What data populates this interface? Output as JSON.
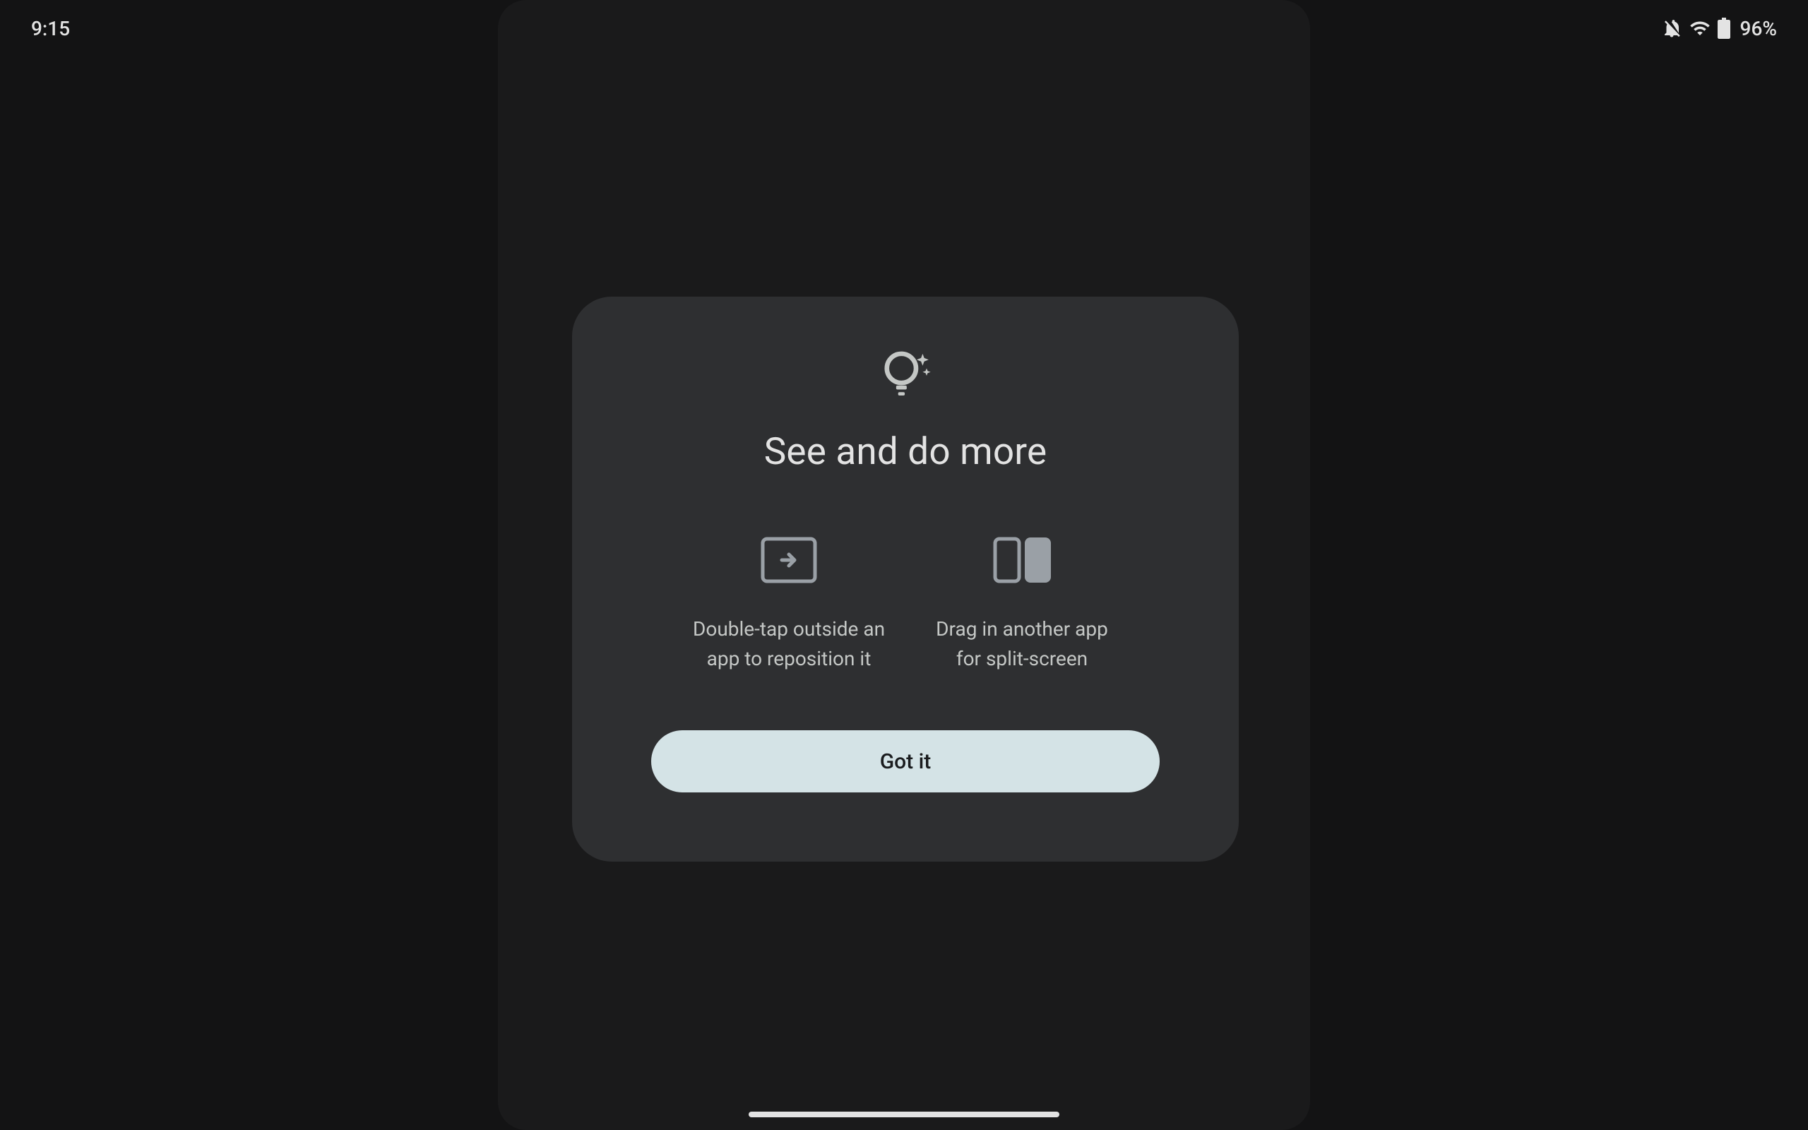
{
  "status_bar": {
    "time": "9:15",
    "battery_percent": "96%"
  },
  "dialog": {
    "title": "See and do more",
    "tips": [
      {
        "icon_name": "reposition-icon",
        "text": "Double-tap outside an app to reposition it"
      },
      {
        "icon_name": "split-screen-icon",
        "text": "Drag in another app for split-screen"
      }
    ],
    "confirm_button": "Got it"
  }
}
